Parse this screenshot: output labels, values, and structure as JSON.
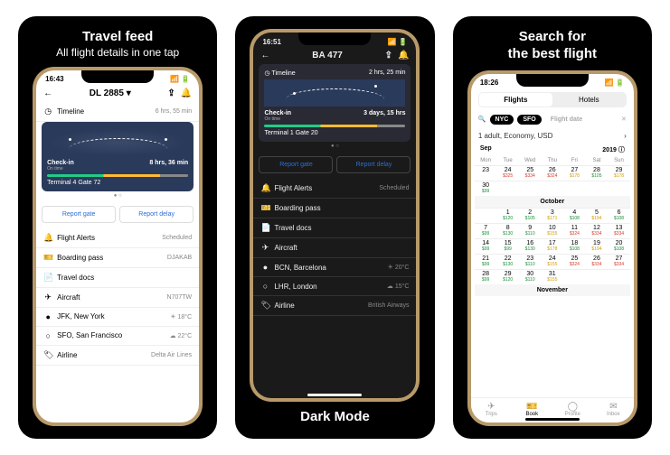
{
  "panel1": {
    "title": "Travel feed",
    "subtitle": "All flight details in one tap",
    "phone": {
      "time": "16:43",
      "flight_title": "DL 2885",
      "timeline_label": "Timeline",
      "timeline_duration": "6 hrs, 55 min",
      "checkin_label": "Check-in",
      "checkin_time": "8 hrs, 36 min",
      "checkin_status": "On time",
      "terminal": "Terminal 4 Gate 72",
      "report_gate": "Report gate",
      "report_delay": "Report delay",
      "rows": [
        {
          "icon": "🔔",
          "label": "Flight Alerts",
          "value": "Scheduled"
        },
        {
          "icon": "🎫",
          "label": "Boarding pass",
          "value": "DJAKAB"
        },
        {
          "icon": "📄",
          "label": "Travel docs",
          "value": ""
        },
        {
          "icon": "✈",
          "label": "Aircraft",
          "value": "N707TW"
        },
        {
          "icon": "●",
          "label": "JFK, New York",
          "value": "☀ 18°C"
        },
        {
          "icon": "○",
          "label": "SFO, San Francisco",
          "value": "☁ 22°C"
        },
        {
          "icon": "🏷",
          "label": "Airline",
          "value": "Delta Air Lines"
        }
      ]
    }
  },
  "panel2": {
    "caption": "Dark Mode",
    "phone": {
      "time": "16:51",
      "flight_title": "BA 477",
      "timeline_label": "Timeline",
      "timeline_duration": "2 hrs, 25 min",
      "checkin_label": "Check-in",
      "checkin_time": "3 days, 15 hrs",
      "checkin_status": "On time",
      "terminal": "Terminal 1 Gate 20",
      "report_gate": "Report gate",
      "report_delay": "Report delay",
      "rows": [
        {
          "icon": "🔔",
          "label": "Flight Alerts",
          "value": "Scheduled"
        },
        {
          "icon": "🎫",
          "label": "Boarding pass",
          "value": ""
        },
        {
          "icon": "📄",
          "label": "Travel docs",
          "value": ""
        },
        {
          "icon": "✈",
          "label": "Aircraft",
          "value": ""
        },
        {
          "icon": "●",
          "label": "BCN, Barcelona",
          "value": "☀ 20°C"
        },
        {
          "icon": "○",
          "label": "LHR, London",
          "value": "☁ 15°C"
        },
        {
          "icon": "🏷",
          "label": "Airline",
          "value": "British Airways"
        }
      ]
    }
  },
  "panel3": {
    "title": "Search for",
    "subtitle": "the best flight",
    "phone": {
      "time": "18:26",
      "seg": {
        "flights": "Flights",
        "hotels": "Hotels"
      },
      "from": "NYC",
      "to": "SFO",
      "date_ph": "Flight date",
      "pax": "1 adult, Economy, USD",
      "month1": "Sep",
      "year": "2019",
      "days": [
        "Mon",
        "Tue",
        "Wed",
        "Thu",
        "Fri",
        "Sat",
        "Sun"
      ],
      "week_sep_prices": [
        {
          "d": "23",
          "p": ""
        },
        {
          "d": "24",
          "p": "$325",
          "c": "r"
        },
        {
          "d": "25",
          "p": "$334",
          "c": "r"
        },
        {
          "d": "26",
          "p": "$324",
          "c": "r"
        },
        {
          "d": "27",
          "p": "$178",
          "c": "y"
        },
        {
          "d": "28",
          "p": "$105",
          "c": "g"
        },
        {
          "d": "29",
          "p": "$178",
          "c": "y"
        }
      ],
      "week_sep2": [
        {
          "d": "30",
          "p": "$99",
          "c": "g"
        },
        {
          "d": "",
          "p": ""
        },
        {
          "d": "",
          "p": ""
        },
        {
          "d": "",
          "p": ""
        },
        {
          "d": "",
          "p": ""
        },
        {
          "d": "",
          "p": ""
        },
        {
          "d": "",
          "p": ""
        }
      ],
      "month2": "October",
      "oct": [
        [
          null,
          {
            "d": "1",
            "p": "$120",
            "c": "g"
          },
          {
            "d": "2",
            "p": "$105",
            "c": "g"
          },
          {
            "d": "3",
            "p": "$171",
            "c": "y"
          },
          {
            "d": "4",
            "p": "$108",
            "c": "g"
          },
          {
            "d": "5",
            "p": "$194",
            "c": "y"
          },
          {
            "d": "6",
            "p": "$108",
            "c": "g"
          }
        ],
        [
          {
            "d": "7",
            "p": "$99",
            "c": "g"
          },
          {
            "d": "8",
            "p": "$130",
            "c": "g"
          },
          {
            "d": "9",
            "p": "$110",
            "c": "g"
          },
          {
            "d": "10",
            "p": "$155",
            "c": "y"
          },
          {
            "d": "11",
            "p": "$324",
            "c": "r"
          },
          {
            "d": "12",
            "p": "$334",
            "c": "r"
          },
          {
            "d": "13",
            "p": "$334",
            "c": "r"
          }
        ],
        [
          {
            "d": "14",
            "p": "$99",
            "c": "g"
          },
          {
            "d": "15",
            "p": "$99",
            "c": "g"
          },
          {
            "d": "16",
            "p": "$130",
            "c": "g"
          },
          {
            "d": "17",
            "p": "$178",
            "c": "y"
          },
          {
            "d": "18",
            "p": "$108",
            "c": "g"
          },
          {
            "d": "19",
            "p": "$194",
            "c": "y"
          },
          {
            "d": "20",
            "p": "$108",
            "c": "g"
          }
        ],
        [
          {
            "d": "21",
            "p": "$99",
            "c": "g"
          },
          {
            "d": "22",
            "p": "$130",
            "c": "g"
          },
          {
            "d": "23",
            "p": "$110",
            "c": "g"
          },
          {
            "d": "24",
            "p": "$155",
            "c": "y"
          },
          {
            "d": "25",
            "p": "$324",
            "c": "r"
          },
          {
            "d": "26",
            "p": "$334",
            "c": "r"
          },
          {
            "d": "27",
            "p": "$334",
            "c": "r"
          }
        ],
        [
          {
            "d": "28",
            "p": "$99",
            "c": "g"
          },
          {
            "d": "29",
            "p": "$120",
            "c": "g"
          },
          {
            "d": "30",
            "p": "$110",
            "c": "g"
          },
          {
            "d": "31",
            "p": "$155",
            "c": "y"
          },
          null,
          null,
          null
        ]
      ],
      "month3": "November",
      "tabs": [
        {
          "icon": "✈",
          "label": "Trips"
        },
        {
          "icon": "🎫",
          "label": "Book"
        },
        {
          "icon": "◯",
          "label": "Profile"
        },
        {
          "icon": "✉",
          "label": "Inbox"
        }
      ]
    }
  }
}
